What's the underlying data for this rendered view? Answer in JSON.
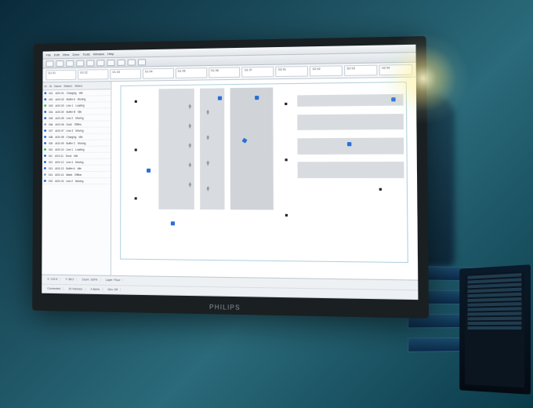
{
  "menubar": {
    "items": [
      "File",
      "Edit",
      "View",
      "Zone",
      "Tools",
      "Window",
      "Help"
    ]
  },
  "toolbar": {
    "buttons": [
      "new",
      "open",
      "save",
      "undo",
      "redo",
      "zoom-in",
      "zoom-out",
      "play",
      "pause",
      "stop"
    ]
  },
  "ribbon": {
    "chips": [
      "G1 01",
      "G1 02",
      "G1 03",
      "G1 04",
      "G1 05",
      "G1 06",
      "G1 07",
      "G2 01",
      "G2 02",
      "G2 03",
      "G2 04"
    ]
  },
  "sidepanel": {
    "columns": [
      "ID",
      "St",
      "Name",
      "Station",
      "Status"
    ],
    "rows": [
      {
        "led": "blue",
        "id": "001",
        "name": "AGV-01",
        "station": "Charging",
        "status": "Idle"
      },
      {
        "led": "blue",
        "id": "002",
        "name": "AGV-02",
        "station": "Buffer A",
        "status": "Moving"
      },
      {
        "led": "green",
        "id": "003",
        "name": "AGV-03",
        "station": "Line 1",
        "status": "Loading"
      },
      {
        "led": "blue",
        "id": "004",
        "name": "AGV-04",
        "station": "Buffer B",
        "status": "Idle"
      },
      {
        "led": "blue",
        "id": "005",
        "name": "AGV-05",
        "station": "Line 2",
        "status": "Moving"
      },
      {
        "led": "gray",
        "id": "006",
        "name": "AGV-06",
        "station": "Dock",
        "status": "Offline"
      },
      {
        "led": "blue",
        "id": "007",
        "name": "AGV-07",
        "station": "Line 3",
        "status": "Moving"
      },
      {
        "led": "blue",
        "id": "008",
        "name": "AGV-08",
        "station": "Charging",
        "status": "Idle"
      },
      {
        "led": "blue",
        "id": "009",
        "name": "AGV-09",
        "station": "Buffer C",
        "status": "Moving"
      },
      {
        "led": "green",
        "id": "010",
        "name": "AGV-10",
        "station": "Line 1",
        "status": "Loading"
      },
      {
        "led": "blue",
        "id": "011",
        "name": "AGV-11",
        "station": "Dock",
        "status": "Idle"
      },
      {
        "led": "blue",
        "id": "012",
        "name": "AGV-12",
        "station": "Line 4",
        "status": "Moving"
      },
      {
        "led": "blue",
        "id": "013",
        "name": "AGV-13",
        "station": "Buffer A",
        "status": "Idle"
      },
      {
        "led": "gray",
        "id": "014",
        "name": "AGV-14",
        "station": "Maint",
        "status": "Offline"
      },
      {
        "led": "blue",
        "id": "015",
        "name": "AGV-15",
        "station": "Line 2",
        "status": "Moving"
      }
    ]
  },
  "statusbar": {
    "row1": [
      "X: 124.5",
      "Y: 88.2",
      "Zoom: 100%",
      "Layer: Floor"
    ],
    "row2": [
      "Connected",
      "15 Vehicles",
      "2 Alerts",
      "Sim: Off"
    ]
  },
  "brand": "PHILIPS"
}
